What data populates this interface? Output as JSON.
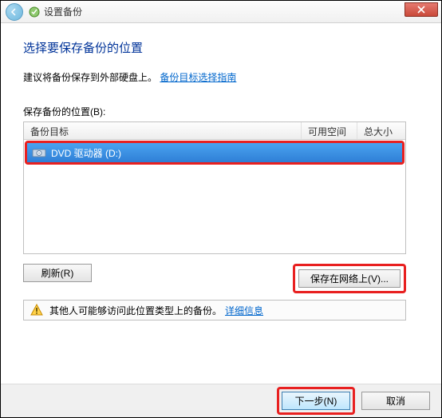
{
  "window": {
    "title": "设置备份"
  },
  "main": {
    "heading": "选择要保存备份的位置",
    "advice_text": "建议将备份保存到外部硬盘上。",
    "advice_link": "备份目标选择指南",
    "location_label": "保存备份的位置(B):"
  },
  "table": {
    "columns": {
      "target": "备份目标",
      "available": "可用空间",
      "total": "总大小"
    },
    "rows": [
      {
        "name": "DVD 驱动器 (D:)",
        "available": "",
        "total": ""
      }
    ]
  },
  "buttons": {
    "refresh": "刷新(R)",
    "network": "保存在网络上(V)...",
    "next": "下一步(N)",
    "cancel": "取消"
  },
  "warning": {
    "text": "其他人可能够访问此位置类型上的备份。",
    "link": "详细信息"
  }
}
